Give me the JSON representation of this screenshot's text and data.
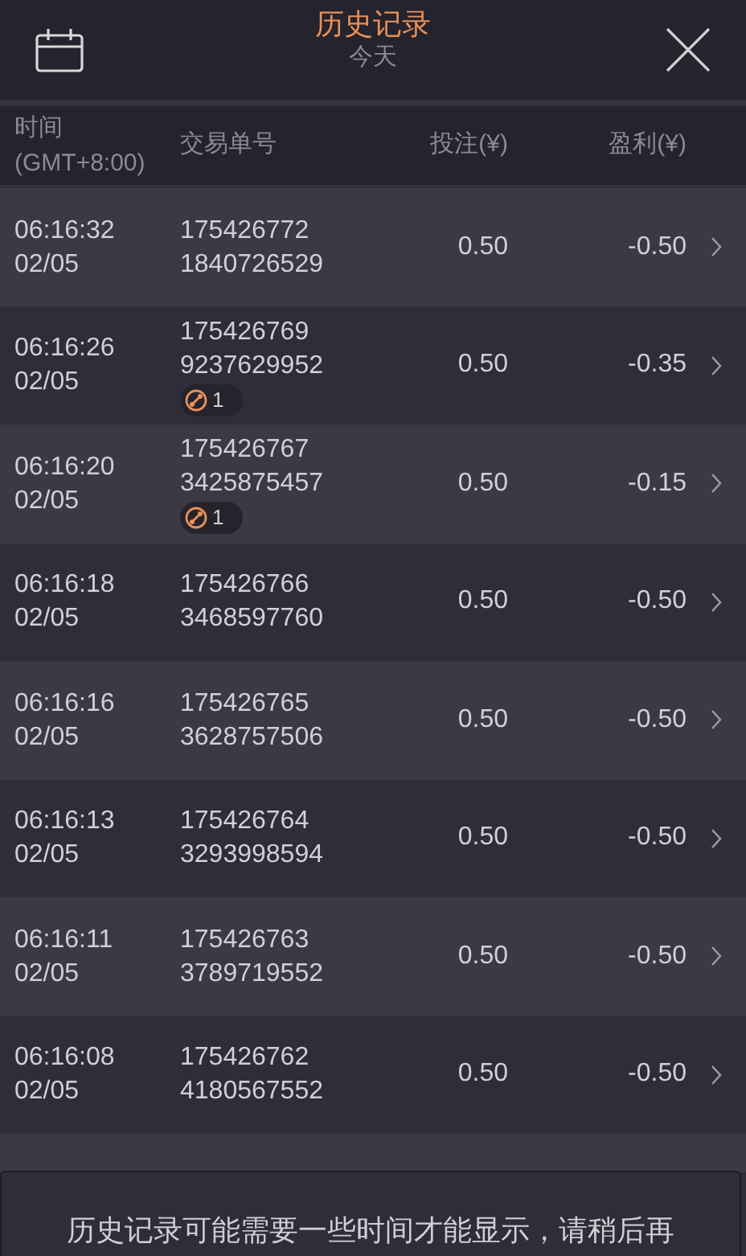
{
  "header": {
    "title": "历史记录",
    "subtitle": "今天"
  },
  "columns": [
    {
      "label": "时间\n(GMT+8:00)"
    },
    {
      "label": "交易单号"
    },
    {
      "label": "投注(¥)"
    },
    {
      "label": "盈利(¥)"
    }
  ],
  "rows": [
    {
      "time": "06:16:32",
      "date": "02/05",
      "order": [
        "175426772",
        "1840726529"
      ],
      "bet": "0.50",
      "profit": "-0.50"
    },
    {
      "time": "06:16:26",
      "date": "02/05",
      "order": [
        "175426769",
        "9237629952"
      ],
      "badge": "1",
      "bet": "0.50",
      "profit": "-0.35"
    },
    {
      "time": "06:16:20",
      "date": "02/05",
      "order": [
        "175426767",
        "3425875457"
      ],
      "badge": "1",
      "bet": "0.50",
      "profit": "-0.15"
    },
    {
      "time": "06:16:18",
      "date": "02/05",
      "order": [
        "175426766",
        "3468597760"
      ],
      "bet": "0.50",
      "profit": "-0.50"
    },
    {
      "time": "06:16:16",
      "date": "02/05",
      "order": [
        "175426765",
        "3628757506"
      ],
      "bet": "0.50",
      "profit": "-0.50"
    },
    {
      "time": "06:16:13",
      "date": "02/05",
      "order": [
        "175426764",
        "3293998594"
      ],
      "bet": "0.50",
      "profit": "-0.50"
    },
    {
      "time": "06:16:11",
      "date": "02/05",
      "order": [
        "175426763",
        "3789719552"
      ],
      "bet": "0.50",
      "profit": "-0.50"
    },
    {
      "time": "06:16:08",
      "date": "02/05",
      "order": [
        "175426762",
        "4180567552"
      ],
      "bet": "0.50",
      "profit": "-0.50"
    }
  ],
  "toast": {
    "message": "历史记录可能需要一些时间才能显示，请稍后再"
  }
}
